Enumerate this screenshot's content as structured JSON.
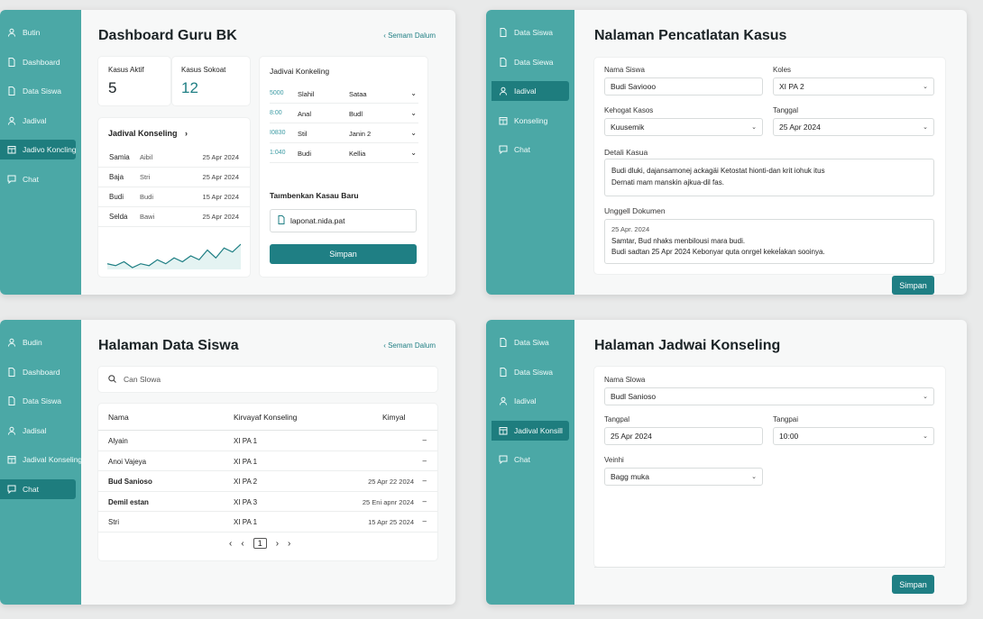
{
  "colors": {
    "accent": "#1f7f84",
    "sidebar": "#4ba8a6",
    "sidebar_active": "#1e7d7e",
    "background": "#e9eaea"
  },
  "panel1": {
    "sidebar": [
      {
        "label": "Butin",
        "icon": "user-icon",
        "active": false
      },
      {
        "label": "Dashboard",
        "icon": "document-icon",
        "active": false
      },
      {
        "label": "Data Siswa",
        "icon": "document-icon",
        "active": false
      },
      {
        "label": "Jadival",
        "icon": "user-icon",
        "active": false
      },
      {
        "label": "Jadivo Koncling",
        "icon": "calendar-icon",
        "active": true
      },
      {
        "label": "Chat",
        "icon": "chat-icon",
        "active": false
      }
    ],
    "title": "Dashboard Guru BK",
    "back": "‹ Semam Dalum",
    "stats": [
      {
        "label": "Kasus Aktif",
        "value": "5"
      },
      {
        "label": "Kasus Sokoat",
        "value": "12"
      }
    ],
    "schedule_title": "Jadival Konseling",
    "schedule_rows": [
      {
        "name": "Samia",
        "who": "Aibil",
        "date": "25 Apr 2024"
      },
      {
        "name": "Baja",
        "who": "Stri",
        "date": "25 Apr 2024"
      },
      {
        "name": "Budi",
        "who": "Budi",
        "date": "15 Apr 2024"
      },
      {
        "name": "Selda",
        "who": "Bawi",
        "date": "25 Apr 2024"
      }
    ],
    "sparkline": [
      6,
      5,
      7,
      4,
      6,
      5,
      8,
      6,
      9,
      7,
      10,
      8,
      13,
      9,
      14,
      12,
      16
    ],
    "right_title": "Jadivai Konkeling",
    "right_rows": [
      {
        "time": "5000",
        "name": "Slahil",
        "status": "Sataa"
      },
      {
        "time": "8:00",
        "name": "Anal",
        "status": "Budl"
      },
      {
        "time": "I0830",
        "name": "Stil",
        "status": "Janin 2"
      },
      {
        "time": "1:040",
        "name": "Budi",
        "status": "Kellia"
      }
    ],
    "add_title": "Taımbenkan Kasau Baru",
    "file_name": "laponat.nida.pat",
    "save": "Simpan"
  },
  "panel2": {
    "sidebar": [
      {
        "label": "Data Siswa",
        "icon": "document-icon",
        "active": false
      },
      {
        "label": "Data Siewa",
        "icon": "document-icon",
        "active": false
      },
      {
        "label": "Iadival",
        "icon": "user-icon",
        "active": true
      },
      {
        "label": "Konseling",
        "icon": "calendar-icon",
        "active": false
      },
      {
        "label": "Chat",
        "icon": "chat-icon",
        "active": false
      }
    ],
    "title": "Nalaman Pencatlatan Kasus",
    "fields": {
      "nama_label": "Nama Siswa",
      "nama_value": "Budi Saviooo",
      "kelas_label": "Koles",
      "kelas_value": "XI PA 2",
      "kategori_label": "Kehogat Kasos",
      "kategori_value": "Kuusemik",
      "tanggal_label": "Tanggal",
      "tanggal_value": "25 Apr 2024",
      "detail_label": "Detali Kasua",
      "detail_line1": "Budi dluki, dajansamonej ackagäi Ketostat hionti-dan krit iohuk itus",
      "detail_line2": "Dernati mam manskin ajkua-dil fas.",
      "upload_label": "Unggell Dokumen",
      "upload_date": "25 Apr. 2024",
      "upload_line1": "Samtar, Bud nhaks menbilousi mara budi.",
      "upload_line2": "Budi sadtan 25 Apr 2024 Kebonyar quta onrgel kekeĺakan sooinya."
    },
    "save": "Simpan"
  },
  "panel3": {
    "sidebar": [
      {
        "label": "Budin",
        "icon": "user-icon",
        "active": false
      },
      {
        "label": "Dashboard",
        "icon": "document-icon",
        "active": false
      },
      {
        "label": "Data Siswa",
        "icon": "document-icon",
        "active": false
      },
      {
        "label": "Jadisal",
        "icon": "user-icon",
        "active": false
      },
      {
        "label": "Jadival Konseling",
        "icon": "calendar-icon",
        "active": false
      },
      {
        "label": "Chat",
        "icon": "chat-icon",
        "active": true
      }
    ],
    "title": "Halaman Data Siswa",
    "back": "‹ Semam Dalum",
    "search_placeholder": "Can Slowa",
    "columns": [
      "Nama",
      "Kirvayaf Konseling",
      "Kimyal"
    ],
    "rows": [
      {
        "name": "Alyain",
        "kelas": "XI PA 1",
        "date": "",
        "action": "–",
        "bold": false
      },
      {
        "name": "Anoi Vajeya",
        "kelas": "XI PA 1",
        "date": "",
        "action": "–",
        "bold": false
      },
      {
        "name": "Bud Sanioso",
        "kelas": "XI PA 2",
        "date": "25 Apr 22 2024",
        "action": "–",
        "bold": true
      },
      {
        "name": "Demil estan",
        "kelas": "XI PA 3",
        "date": "25 Eni apnr 2024",
        "action": "–",
        "bold": true
      },
      {
        "name": "Stri",
        "kelas": "XI PA 1",
        "date": "15 Apr 25 2024",
        "action": "–",
        "bold": false
      }
    ],
    "pagination": {
      "first": "‹",
      "prev": "‹",
      "current": "1",
      "next": "›",
      "last": "›"
    }
  },
  "panel4": {
    "sidebar": [
      {
        "label": "Data Siwa",
        "icon": "document-icon",
        "active": false
      },
      {
        "label": "Data Siswa",
        "icon": "document-icon",
        "active": false
      },
      {
        "label": "Iadival",
        "icon": "user-icon",
        "active": false
      },
      {
        "label": "Jadival Konsill",
        "icon": "calendar-icon",
        "active": true
      },
      {
        "label": "Chat",
        "icon": "chat-icon",
        "active": false
      }
    ],
    "title": "Halaman Jadwai Konseling",
    "fields": {
      "nama_label": "Nama Slowa",
      "nama_value": "Budl Sanioso",
      "tanggal_label": "Tangpal",
      "tanggal_value": "25 Apr 2024",
      "waktu_label": "Tangpai",
      "waktu_value": "10:00",
      "via_label": "Veinhi",
      "via_value": "Bagg muka"
    },
    "save": "Simpan"
  }
}
